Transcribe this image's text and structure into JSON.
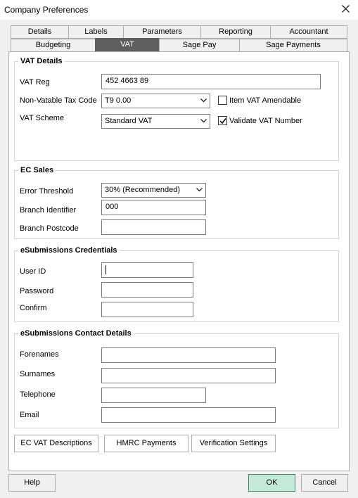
{
  "window": {
    "title": "Company Preferences"
  },
  "tabs_row1": [
    "Details",
    "Labels",
    "Parameters",
    "Reporting",
    "Accountant"
  ],
  "tabs_row2": [
    "Budgeting",
    "VAT",
    "Sage Pay",
    "Sage Payments"
  ],
  "active_tab": "VAT",
  "vat_details": {
    "legend": "VAT Details",
    "vat_reg_label": "VAT Reg",
    "vat_reg_value": "452 4663 89",
    "non_vatable_label": "Non-Vatable Tax Code",
    "non_vatable_value": "T9  0.00",
    "item_vat_amendable_label": "Item VAT Amendable",
    "item_vat_amendable_checked": false,
    "vat_scheme_label": "VAT Scheme",
    "vat_scheme_value": "Standard VAT",
    "validate_vat_label": "Validate VAT Number",
    "validate_vat_checked": true
  },
  "ec_sales": {
    "legend": "EC Sales",
    "error_threshold_label": "Error Threshold",
    "error_threshold_value": "30% (Recommended)",
    "branch_identifier_label": "Branch Identifier",
    "branch_identifier_value": "000",
    "branch_postcode_label": "Branch Postcode",
    "branch_postcode_value": ""
  },
  "credentials": {
    "legend": "eSubmissions Credentials",
    "user_id_label": "User ID",
    "password_label": "Password",
    "confirm_label": "Confirm"
  },
  "contact": {
    "legend": "eSubmissions Contact Details",
    "forenames_label": "Forenames",
    "surnames_label": "Surnames",
    "telephone_label": "Telephone",
    "email_label": "Email"
  },
  "panel_buttons": {
    "ec_vat": "EC VAT Descriptions",
    "hmrc": "HMRC Payments",
    "verification": "Verification Settings"
  },
  "footer": {
    "help": "Help",
    "ok": "OK",
    "cancel": "Cancel"
  },
  "colors": {
    "active_tab_bg": "#5e5e5e",
    "ok_button_bg": "#c5e9d8"
  }
}
